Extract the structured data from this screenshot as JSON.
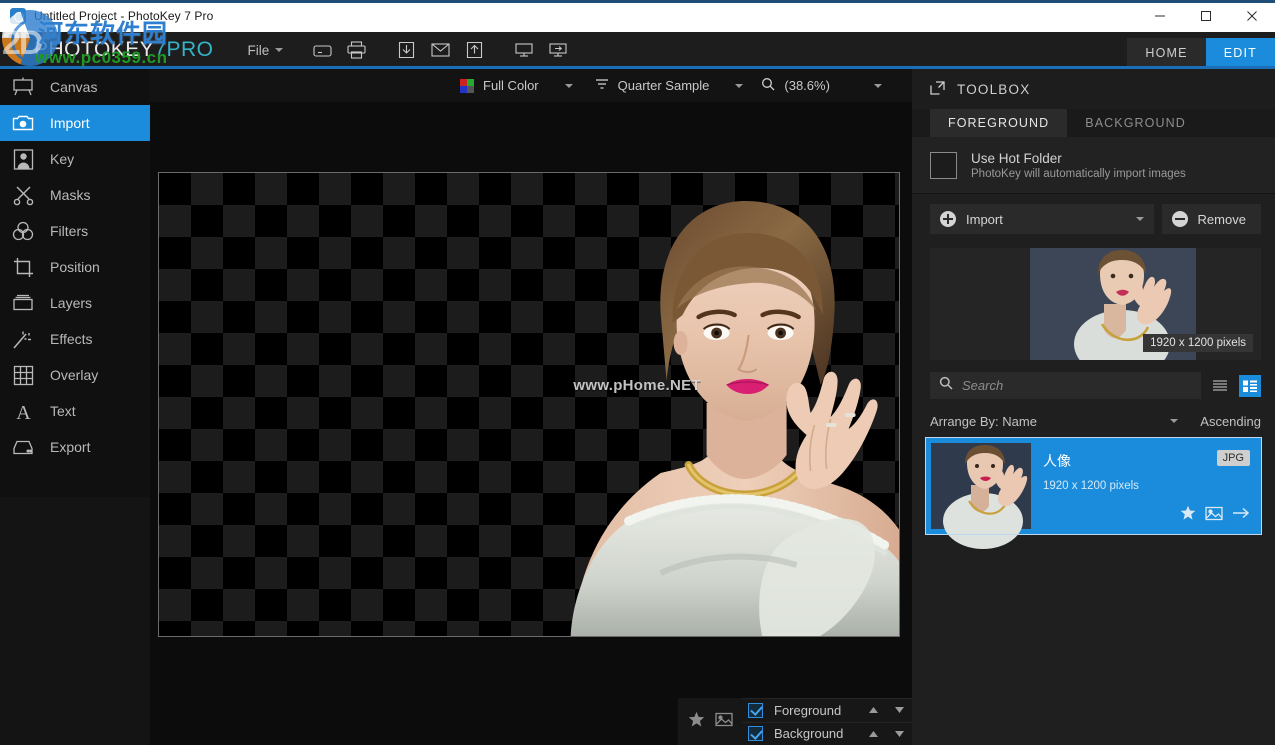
{
  "window": {
    "title": "Untitled Project - PhotoKey 7 Pro",
    "app_icon": "photokey-app-icon",
    "minimize_label": "minimize-icon",
    "maximize_label": "maximize-icon",
    "close_label": "close-icon"
  },
  "watermark": {
    "chinese": "河东软件园",
    "url": "www.pc0359.cn",
    "mark_2d": "2D"
  },
  "ribbon": {
    "logo_part1": "PHOTOKEY",
    "logo_num": "7",
    "logo_part2": "PRO",
    "file_menu": "File",
    "tools": [
      {
        "name": "save-icon"
      },
      {
        "name": "print-icon"
      },
      {
        "name": "import-icon"
      },
      {
        "name": "email-icon"
      },
      {
        "name": "export-icon"
      },
      {
        "name": "monitor-icon"
      },
      {
        "name": "monitor-transfer-icon"
      }
    ],
    "tabs": [
      {
        "label": "HOME",
        "active": false
      },
      {
        "label": "EDIT",
        "active": true
      }
    ],
    "accent_color": "#1a8cdb"
  },
  "optionbar": {
    "color_mode": "Full Color",
    "sample_mode": "Quarter Sample",
    "zoom": "(38.6%)",
    "color_swatch": [
      "#cc2222",
      "#22aa33",
      "#2233cc",
      "#555555"
    ]
  },
  "sidebar": {
    "items": [
      {
        "label": "Canvas",
        "icon": "canvas-icon",
        "active": false
      },
      {
        "label": "Import",
        "icon": "camera-icon",
        "active": true
      },
      {
        "label": "Key",
        "icon": "portrait-icon",
        "active": false
      },
      {
        "label": "Masks",
        "icon": "scissors-icon",
        "active": false
      },
      {
        "label": "Filters",
        "icon": "venn-circles-icon",
        "active": false
      },
      {
        "label": "Position",
        "icon": "crop-icon",
        "active": false
      },
      {
        "label": "Layers",
        "icon": "layers-icon",
        "active": false
      },
      {
        "label": "Effects",
        "icon": "magic-wand-icon",
        "active": false
      },
      {
        "label": "Overlay",
        "icon": "grid-icon",
        "active": false
      },
      {
        "label": "Text",
        "icon": "text-a-icon",
        "active": false
      },
      {
        "label": "Export",
        "icon": "export-drive-icon",
        "active": false
      }
    ]
  },
  "canvas": {
    "watermark_text": "www.pHome.NET"
  },
  "layers": {
    "rows": [
      {
        "label": "Foreground",
        "checked": true
      },
      {
        "label": "Background",
        "checked": true
      }
    ],
    "star_icon": "star-icon",
    "image_icon": "image-icon",
    "up_icon": "arrow-up-icon",
    "down_icon": "arrow-down-icon"
  },
  "toolbox": {
    "title": "TOOLBOX",
    "popout_icon": "popout-icon",
    "tabs": [
      {
        "label": "FOREGROUND",
        "active": true
      },
      {
        "label": "BACKGROUND",
        "active": false
      }
    ],
    "hot_folder": {
      "label": "Use Hot Folder",
      "description": "PhotoKey will automatically import images",
      "checked": false
    },
    "import_button": "Import",
    "remove_button": "Remove",
    "preview": {
      "dimensions_badge": "1920 x 1200 pixels"
    },
    "search": {
      "placeholder": "Search",
      "value": "",
      "icon": "search-icon"
    },
    "view_modes": [
      {
        "name": "list-view-icon",
        "active": false
      },
      {
        "name": "grid-view-icon",
        "active": true
      }
    ],
    "arrange_by": "Arrange By: Name",
    "sort_order": "Ascending",
    "files": [
      {
        "name": "人像",
        "dimensions": "1920 x 1200 pixels",
        "extension": "JPG",
        "selected": true
      }
    ]
  }
}
